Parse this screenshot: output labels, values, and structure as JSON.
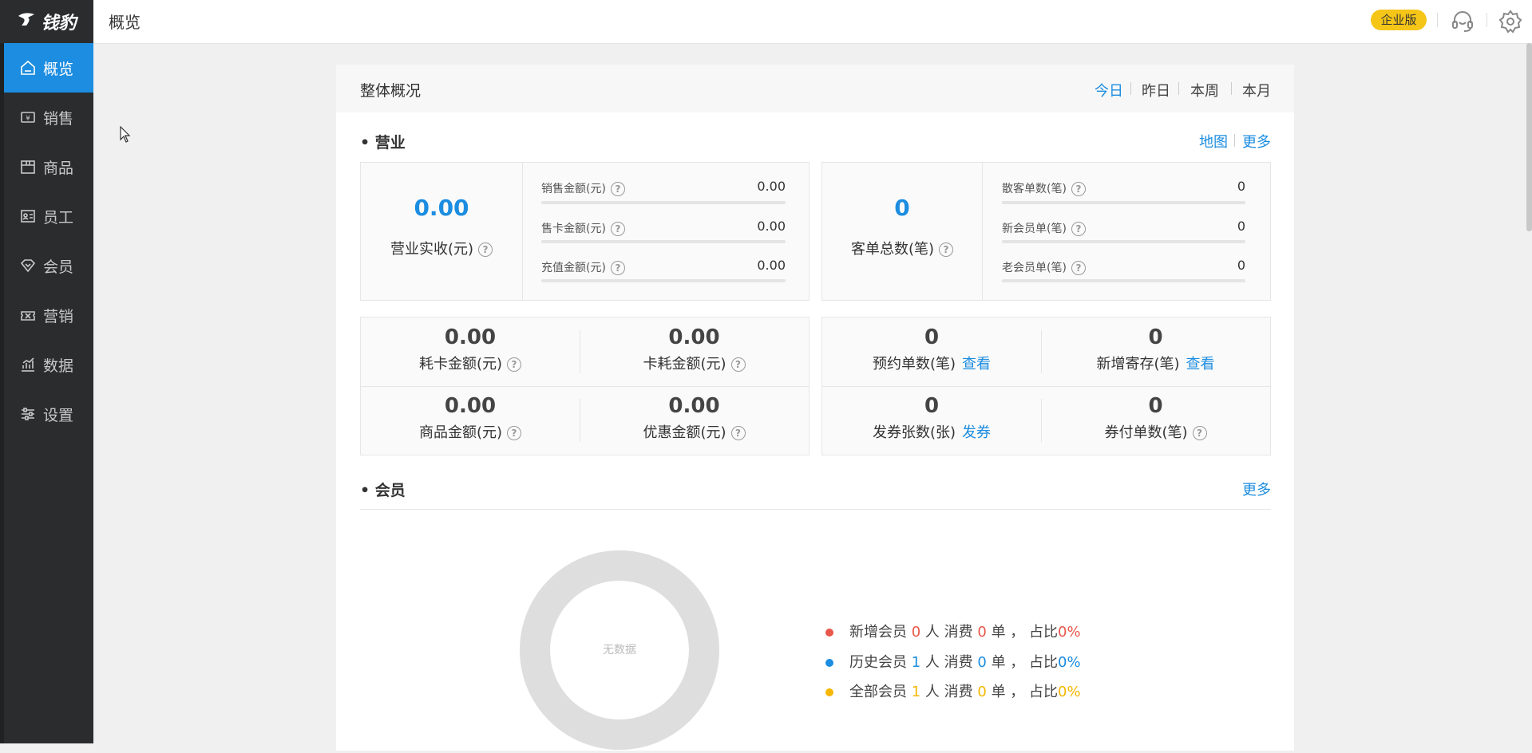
{
  "app": {
    "logo_text": "钱豹",
    "page_title": "概览",
    "edition_badge": "企业版",
    "icons": {
      "support": "headset-icon",
      "settings": "gear-icon"
    }
  },
  "sidebar": {
    "items": [
      {
        "label": "概览",
        "icon": "home-icon",
        "active": true
      },
      {
        "label": "销售",
        "icon": "cash-icon",
        "active": false
      },
      {
        "label": "商品",
        "icon": "box-icon",
        "active": false
      },
      {
        "label": "员工",
        "icon": "id-card-icon",
        "active": false
      },
      {
        "label": "会员",
        "icon": "diamond-icon",
        "active": false
      },
      {
        "label": "营销",
        "icon": "ticket-icon",
        "active": false
      },
      {
        "label": "数据",
        "icon": "chart-icon",
        "active": false
      },
      {
        "label": "设置",
        "icon": "sliders-icon",
        "active": false
      }
    ]
  },
  "overview": {
    "title": "整体概况",
    "ranges": [
      "今日",
      "昨日",
      "本周",
      "本月"
    ],
    "active_range": "今日"
  },
  "business": {
    "title": "营业",
    "links": [
      "地图",
      "更多"
    ],
    "revenue": {
      "value": "0.00",
      "label": "营业实收(元)",
      "items": [
        {
          "label": "销售金额(元)",
          "value": "0.00"
        },
        {
          "label": "售卡金额(元)",
          "value": "0.00"
        },
        {
          "label": "充值金额(元)",
          "value": "0.00"
        }
      ]
    },
    "orders": {
      "value": "0",
      "label": "客单总数(笔)",
      "items": [
        {
          "label": "散客单数(笔)",
          "value": "0"
        },
        {
          "label": "新会员单(笔)",
          "value": "0"
        },
        {
          "label": "老会员单(笔)",
          "value": "0"
        }
      ]
    },
    "amounts": [
      {
        "value": "0.00",
        "label": "耗卡金额(元)"
      },
      {
        "value": "0.00",
        "label": "卡耗金额(元)"
      },
      {
        "value": "0.00",
        "label": "商品金额(元)"
      },
      {
        "value": "0.00",
        "label": "优惠金额(元)"
      }
    ],
    "counts": [
      {
        "value": "0",
        "label": "预约单数(笔)",
        "link": "查看"
      },
      {
        "value": "0",
        "label": "新增寄存(笔)",
        "link": "查看"
      },
      {
        "value": "0",
        "label": "发券张数(张)",
        "link": "发券"
      },
      {
        "value": "0",
        "label": "券付单数(笔)"
      }
    ]
  },
  "members": {
    "title": "会员",
    "more": "更多",
    "donut_empty_text": "无数据",
    "legend": [
      {
        "prefix": "新增会员",
        "count": "0",
        "mid1": "人 消费",
        "orders": "0",
        "mid2": "单 ， 占比",
        "ratio": "0%",
        "color": "#e8574a"
      },
      {
        "prefix": "历史会员",
        "count": "1",
        "mid1": "人 消费",
        "orders": "0",
        "mid2": "单 ， 占比",
        "ratio": "0%",
        "color": "#1c8de0"
      },
      {
        "prefix": "全部会员",
        "count": "1",
        "mid1": "人 消费",
        "orders": "0",
        "mid2": "单 ， 占比",
        "ratio": "0%",
        "color": "#f5b700"
      }
    ]
  },
  "colors": {
    "accent": "#1c8de0",
    "sidebar_bg": "#2a2c2e",
    "badge": "#f5c518"
  }
}
